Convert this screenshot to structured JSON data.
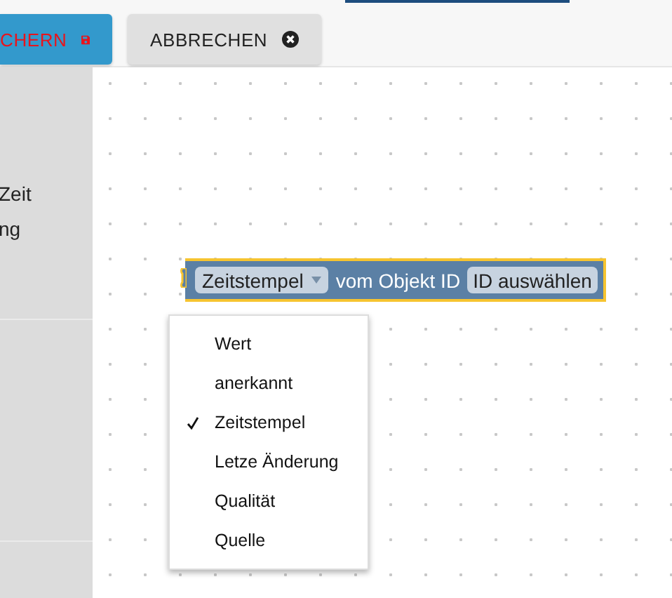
{
  "toolbar": {
    "buttons": [
      {
        "label": "CHERN",
        "kind": "save"
      },
      {
        "label": "ABBRECHEN",
        "kind": "cancel"
      }
    ]
  },
  "sidebar": {
    "lines": [
      "Zeit",
      "ng"
    ]
  },
  "block": {
    "dropdown": "Zeitstempel",
    "text": "vom Objekt ID",
    "field": "ID auswählen"
  },
  "menu": {
    "items": [
      {
        "label": "Wert",
        "selected": false
      },
      {
        "label": "anerkannt",
        "selected": false
      },
      {
        "label": "Zeitstempel",
        "selected": true
      },
      {
        "label": "Letze Änderung",
        "selected": false
      },
      {
        "label": "Qualität",
        "selected": false
      },
      {
        "label": "Quelle",
        "selected": false
      }
    ]
  }
}
